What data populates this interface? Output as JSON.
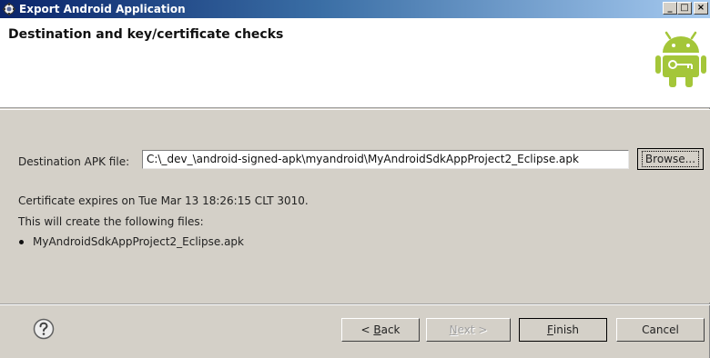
{
  "window": {
    "title": "Export Android Application",
    "minimize_glyph": "_",
    "maximize_glyph": "□",
    "close_glyph": "×"
  },
  "header": {
    "title": "Destination and key/certificate checks",
    "icon": "android-export-icon"
  },
  "destination": {
    "label": "Destination APK file:",
    "value": "C:\\_dev_\\android-signed-apk\\myandroid\\MyAndroidSdkAppProject2_Eclipse.apk",
    "browse_label": "Browse..."
  },
  "info": {
    "certificate_text": "Certificate expires on Tue Mar 13 18:26:15 CLT 3010.",
    "will_create_text": "This will create the following files:",
    "files": [
      "MyAndroidSdkAppProject2_Eclipse.apk"
    ]
  },
  "footer": {
    "help_icon": "help-icon",
    "back_prefix": "< ",
    "back_mnemonic": "B",
    "back_rest": "ack",
    "next_mnemonic": "N",
    "next_rest": "ext >",
    "finish_mnemonic": "F",
    "finish_rest": "inish",
    "cancel_label": "Cancel"
  },
  "colors": {
    "titlebar_start": "#0a246a",
    "titlebar_end": "#a6caf0",
    "android_green": "#a4c639",
    "dialog_gray": "#d4d0c8"
  }
}
